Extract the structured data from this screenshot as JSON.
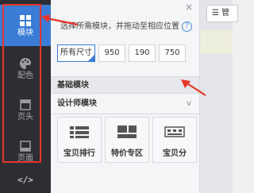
{
  "sidebar": {
    "items": [
      {
        "label": "模块",
        "icon": "grid-icon",
        "active": true
      },
      {
        "label": "配色",
        "icon": "palette-icon",
        "active": false
      },
      {
        "label": "页头",
        "icon": "page-header-icon",
        "active": false
      },
      {
        "label": "页面",
        "icon": "page-icon",
        "active": false
      }
    ],
    "code_icon_label": "</>"
  },
  "panel": {
    "close_label": "×",
    "tip": "选择所需模块，并拖动至相应位置",
    "help_label": "?",
    "sizes": [
      {
        "label": "所有尺寸",
        "selected": true
      },
      {
        "label": "950",
        "selected": false
      },
      {
        "label": "190",
        "selected": false
      },
      {
        "label": "750",
        "selected": false
      }
    ],
    "sections": [
      {
        "label": "基础模块",
        "chevron": "^"
      },
      {
        "label": "设计师模块",
        "chevron": "v"
      }
    ],
    "modules": [
      {
        "label": "宝贝排行"
      },
      {
        "label": "特价专区"
      },
      {
        "label": "宝贝分"
      }
    ]
  },
  "right": {
    "button_label": "☰ 管"
  },
  "colors": {
    "accent": "#3a7cd6",
    "annotation": "#e8352a",
    "rail": "#2c2e33"
  }
}
